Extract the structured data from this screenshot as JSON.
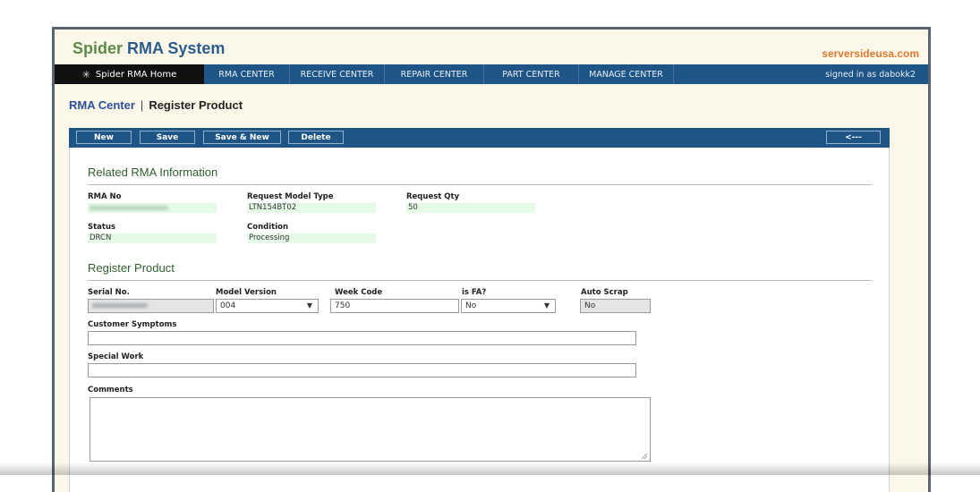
{
  "app": {
    "title_part1": "Spider",
    "title_part2": "RMA System",
    "site": "serversideusa.com"
  },
  "nav": {
    "home": "Spider RMA Home",
    "items": [
      "RMA CENTER",
      "RECEIVE CENTER",
      "REPAIR CENTER",
      "PART CENTER",
      "MANAGE CENTER"
    ],
    "signed_in": "signed in as dabokk2"
  },
  "breadcrumb": {
    "section": "RMA Center",
    "page": "Register Product"
  },
  "toolbar": {
    "new": "New",
    "save": "Save",
    "save_new": "Save & New",
    "delete": "Delete",
    "back": "<---"
  },
  "related": {
    "title": "Related RMA Information",
    "rma_no_label": "RMA No",
    "model_type_label": "Request Model Type",
    "model_type_value": "LTN154BT02",
    "qty_label": "Request Qty",
    "qty_value": "50",
    "status_label": "Status",
    "status_value": "DRCN",
    "condition_label": "Condition",
    "condition_value": "Processing"
  },
  "register": {
    "title": "Register Product",
    "serial_label": "Serial No.",
    "model_version_label": "Model Version",
    "model_version_value": "004",
    "week_code_label": "Week Code",
    "week_code_value": "750",
    "is_fa_label": "is FA?",
    "is_fa_value": "No",
    "auto_scrap_label": "Auto Scrap",
    "auto_scrap_value": "No",
    "symptoms_label": "Customer Symptoms",
    "special_label": "Special Work",
    "comments_label": "Comments"
  },
  "colors": {
    "navbar": "#1f5487",
    "brand_green": "#5d8a48",
    "brand_blue": "#2c5d8c",
    "site_orange": "#e07a2e"
  }
}
